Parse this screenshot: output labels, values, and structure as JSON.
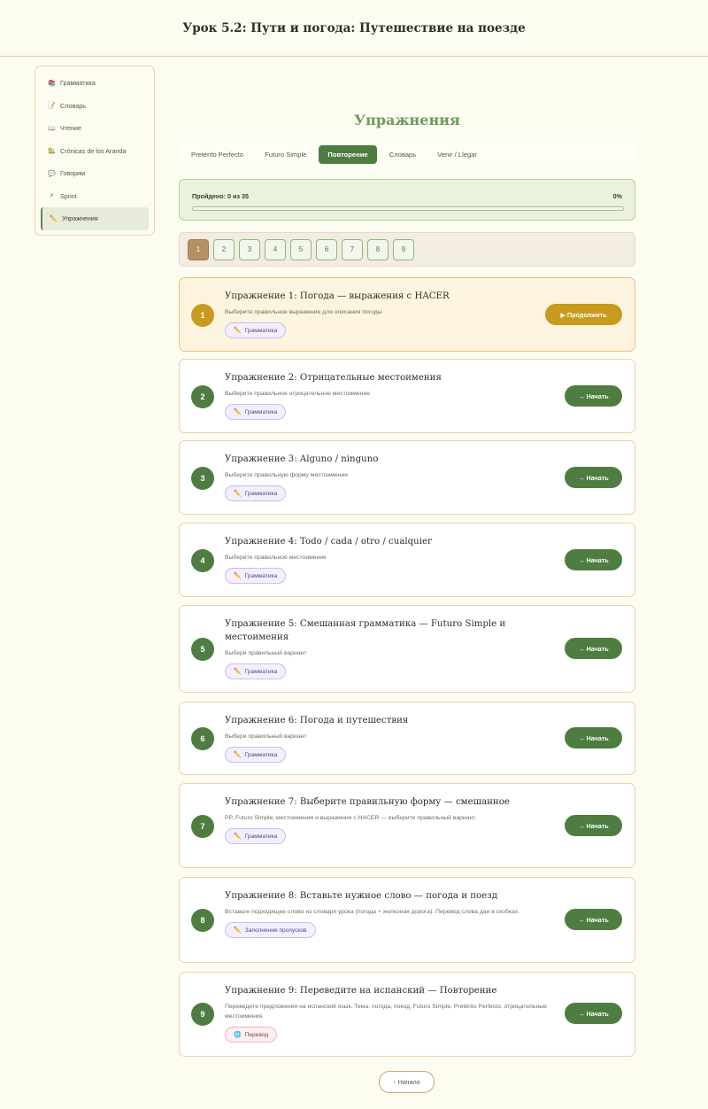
{
  "page_title": "Урок 5.2: Пути и погода: Путешествие на поезде",
  "sidebar": {
    "items": [
      {
        "label": "Грамматика",
        "icon": "📚",
        "active": false
      },
      {
        "label": "Словарь",
        "icon": "📝",
        "active": false
      },
      {
        "label": "Чтение",
        "icon": "📖",
        "active": false
      },
      {
        "label": "Crónicas de los Aranda",
        "icon": "🏡",
        "active": false
      },
      {
        "label": "Говорим",
        "icon": "💬",
        "active": false
      },
      {
        "label": "Sprint",
        "icon": "⚡",
        "active": false
      },
      {
        "label": "Упражнения",
        "icon": "✏️",
        "active": true
      }
    ]
  },
  "section_title": "Упражнения",
  "tabs": [
    "Pretérito Perfecto",
    "Futuro Simple",
    "Повторение",
    "Словарь",
    "Venir / Llegar"
  ],
  "active_tab": 2,
  "progress": {
    "label": "Пройдено: 0 из 35",
    "percent_text": "0%",
    "value": 0
  },
  "pager": {
    "pages": [
      "1",
      "2",
      "3",
      "4",
      "5",
      "6",
      "7",
      "8",
      "9"
    ],
    "active": 0
  },
  "exercises": [
    {
      "number": "1",
      "title": "Упражнение 1: Погода — выражения с HACER",
      "desc": "Выберите правильное выражение для описания погоды",
      "tag": "Грамматика",
      "tag_icon": "✏️",
      "action": "▶ Продолжить",
      "current": true
    },
    {
      "number": "2",
      "title": "Упражнение 2: Отрицательные местоимения",
      "desc": "Выберите правильное отрицательное местоимение",
      "tag": "Грамматика",
      "tag_icon": "✏️",
      "action": "→ Начать"
    },
    {
      "number": "3",
      "title": "Упражнение 3: Alguno / ninguno",
      "desc": "Выберите правильную форму местоимения",
      "tag": "Грамматика",
      "tag_icon": "✏️",
      "action": "→ Начать"
    },
    {
      "number": "4",
      "title": "Упражнение 4: Todo / cada / otro / cualquier",
      "desc": "Выберите правильное местоимение",
      "tag": "Грамматика",
      "tag_icon": "✏️",
      "action": "→ Начать"
    },
    {
      "number": "5",
      "title": "Упражнение 5: Смешанная грамматика — Futuro Simple и местоимения",
      "desc": "Выбери правильный вариант",
      "tag": "Грамматика",
      "tag_icon": "✏️",
      "action": "→ Начать"
    },
    {
      "number": "6",
      "title": "Упражнение 6: Погода и путешествия",
      "desc": "Выбери правильный вариант",
      "tag": "Грамматика",
      "tag_icon": "✏️",
      "action": "→ Начать"
    },
    {
      "number": "7",
      "title": "Упражнение 7: Выберите правильную форму — смешанное",
      "desc": "PP, Futuro Simple, местоимения и выражения с HACER — выберите правильный вариант.",
      "tag": "Грамматика",
      "tag_icon": "✏️",
      "action": "→ Начать"
    },
    {
      "number": "8",
      "title": "Упражнение 8: Вставьте нужное слово — погода и поезд",
      "desc": "Вставьте подходящее слово из словаря урока (погода + железная дорога). Перевод слова дан в скобках.",
      "tag": "Заполнение пропусков",
      "tag_icon": "✏️",
      "action": "→ Начать"
    },
    {
      "number": "9",
      "title": "Упражнение 9: Переведите на испанский — Повторение",
      "desc": "Переведите предложения на испанский язык. Тема: погода, поезд, Futuro Simple, Pretérito Perfecto, отрицательные местоимения.",
      "tag": "Перевод",
      "tag_icon": "🌐",
      "tag_style": "red",
      "action": "→ Начать"
    }
  ],
  "back_button": "↑ Начало",
  "colors": {
    "accent_green": "#4f7d41",
    "accent_gold": "#c89a1e",
    "border": "#ecd2ad",
    "background": "#fdfcf1"
  }
}
